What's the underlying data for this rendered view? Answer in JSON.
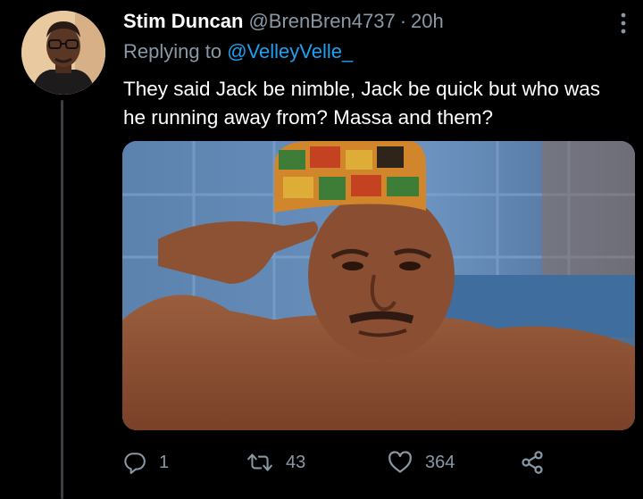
{
  "tweet": {
    "display_name": "Stim Duncan",
    "handle": "@BrenBren4737",
    "separator": "·",
    "time": "20h",
    "replying_prefix": "Replying to",
    "replying_to": "@VelleyVelle_",
    "text": "They said Jack be nimble, Jack be quick but who was he running away from? Massa and them?"
  },
  "actions": {
    "replies": "1",
    "retweets": "43",
    "likes": "364"
  },
  "icons": {
    "more": "more-vertical-icon",
    "reply": "speech-bubble-icon",
    "retweet": "retweet-arrows-icon",
    "like": "heart-icon",
    "share": "share-nodes-icon"
  },
  "colors": {
    "background": "#000000",
    "text": "#ffffff",
    "secondary": "#8899a6",
    "link": "#1da1f2",
    "thread_line": "#3b3f44"
  }
}
